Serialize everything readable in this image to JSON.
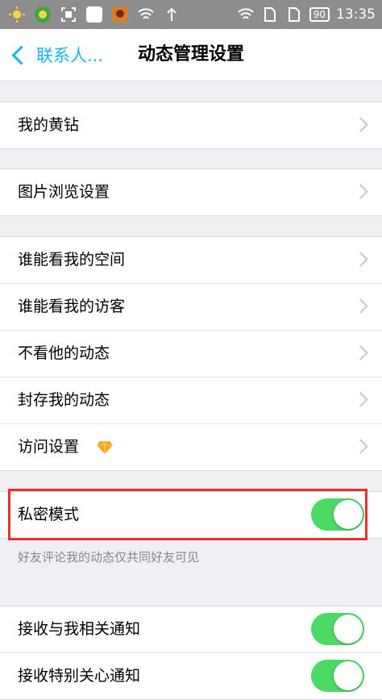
{
  "nav": {
    "back_label": "联系人...",
    "title": "动态管理设置"
  },
  "status": {
    "time": "13:35",
    "battery": "90"
  },
  "groups": [
    {
      "rows": [
        {
          "label": "我的黄钻"
        }
      ]
    },
    {
      "rows": [
        {
          "label": "图片浏览设置"
        }
      ]
    },
    {
      "rows": [
        {
          "label": "谁能看我的空间"
        },
        {
          "label": "谁能看我的访客"
        },
        {
          "label": "不看他的动态"
        },
        {
          "label": "封存我的动态"
        },
        {
          "label": "访问设置"
        }
      ]
    }
  ],
  "private_mode": {
    "label": "私密模式",
    "enabled": true,
    "caption": "好友评论我的动态仅共同好友可见"
  },
  "notifications": [
    {
      "label": "接收与我相关通知",
      "enabled": true
    },
    {
      "label": "接收特别关心通知",
      "enabled": true
    }
  ],
  "colors": {
    "accent": "#12b7f5",
    "toggle_on": "#4cd964",
    "highlight": "#e8302f"
  }
}
